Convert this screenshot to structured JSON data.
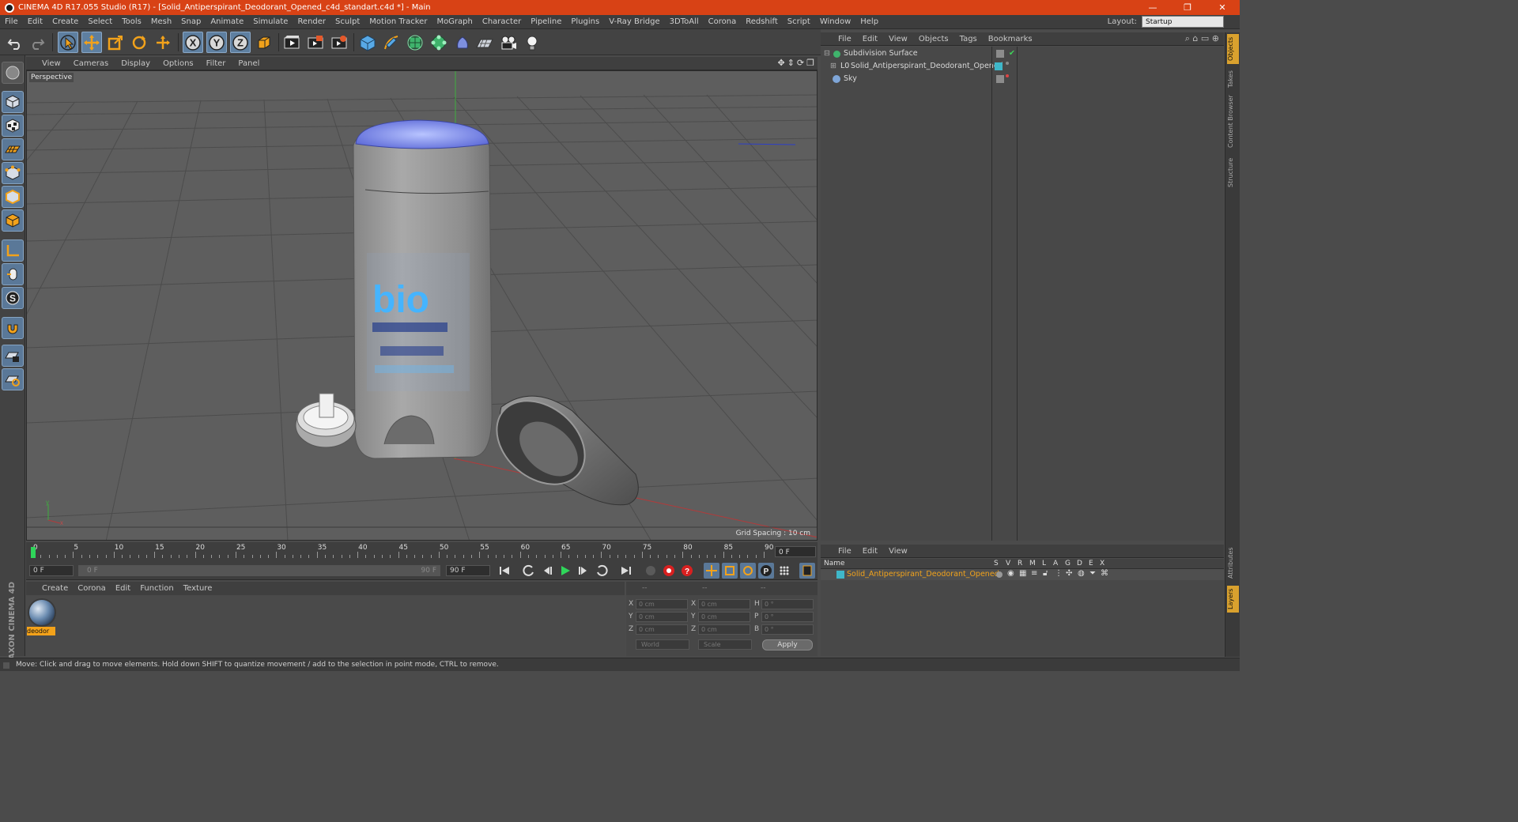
{
  "window": {
    "title": "CINEMA 4D R17.055 Studio (R17) - [Solid_Antiperspirant_Deodorant_Opened_c4d_standart.c4d *] - Main",
    "controls": [
      "—",
      "❐",
      "✕"
    ]
  },
  "menu": [
    "File",
    "Edit",
    "Create",
    "Select",
    "Tools",
    "Mesh",
    "Snap",
    "Animate",
    "Simulate",
    "Render",
    "Sculpt",
    "Motion Tracker",
    "MoGraph",
    "Character",
    "Pipeline",
    "Plugins",
    "V-Ray Bridge",
    "3DToAll",
    "Corona",
    "Redshift",
    "Script",
    "Window",
    "Help"
  ],
  "layout": {
    "label": "Layout:",
    "value": "Startup"
  },
  "toolbar": {
    "icons": [
      "undo-icon",
      "redo-icon",
      "select-icon",
      "move-icon",
      "scale-icon",
      "rotate-icon",
      "move-tool-icon",
      "x-axis-icon",
      "y-axis-icon",
      "z-axis-icon",
      "coordinate-system-icon",
      "render-view-icon",
      "render-picture-viewer-icon",
      "render-settings-icon",
      "cube-icon",
      "pen-icon",
      "subdivision-icon",
      "array-icon",
      "deformer-icon",
      "floor-icon",
      "camera-icon",
      "light-icon"
    ],
    "axis_labels": [
      "X",
      "Y",
      "Z"
    ]
  },
  "viewport": {
    "menu": [
      "View",
      "Cameras",
      "Display",
      "Options",
      "Filter",
      "Panel"
    ],
    "label": "Perspective",
    "grid_spacing": "Grid Spacing : 10 cm",
    "logo_text": "bio"
  },
  "timeline": {
    "ticks": [
      "0",
      "5",
      "10",
      "15",
      "20",
      "25",
      "30",
      "35",
      "40",
      "45",
      "50",
      "55",
      "60",
      "65",
      "70",
      "75",
      "80",
      "85",
      "90"
    ],
    "current_frame": "0 F",
    "start": "0 F",
    "range_start": "0 F",
    "range_end": "90 F",
    "end": "90 F"
  },
  "material_manager": {
    "menu": [
      "Create",
      "Corona",
      "Edit",
      "Function",
      "Texture"
    ],
    "materials": [
      {
        "name": "deodor"
      }
    ]
  },
  "brand": "MAXON CINEMA 4D",
  "coordinates": {
    "header": [
      "--",
      "--",
      "--"
    ],
    "rows": [
      {
        "a": "X",
        "av": "0 cm",
        "b": "X",
        "bv": "0 cm",
        "c": "H",
        "cv": "0 °"
      },
      {
        "a": "Y",
        "av": "0 cm",
        "b": "Y",
        "bv": "0 cm",
        "c": "P",
        "cv": "0 °"
      },
      {
        "a": "Z",
        "av": "0 cm",
        "b": "Z",
        "bv": "0 cm",
        "c": "B",
        "cv": "0 °"
      }
    ],
    "mode1": "World",
    "mode2": "Scale",
    "apply": "Apply"
  },
  "object_manager": {
    "menu": [
      "File",
      "Edit",
      "View",
      "Objects",
      "Tags",
      "Bookmarks"
    ],
    "objects": [
      {
        "name": "Subdivision Surface"
      },
      {
        "name": "Solid_Antiperspirant_Deodorant_Opened"
      },
      {
        "name": "Sky"
      }
    ]
  },
  "right_tabs": [
    "Objects",
    "Takes",
    "Content Browser",
    "Structure",
    "Attributes",
    "Layers"
  ],
  "layer_manager": {
    "menu": [
      "File",
      "Edit",
      "View"
    ],
    "columns": [
      "Name",
      "S",
      "V",
      "R",
      "M",
      "L",
      "A",
      "G",
      "D",
      "E",
      "X"
    ],
    "layers": [
      {
        "name": "Solid_Antiperspirant_Deodorant_Opened",
        "color": "#3fb7c9"
      }
    ]
  },
  "status": "Move: Click and drag to move elements. Hold down SHIFT to quantize movement / add to the selection in point mode, CTRL to remove."
}
